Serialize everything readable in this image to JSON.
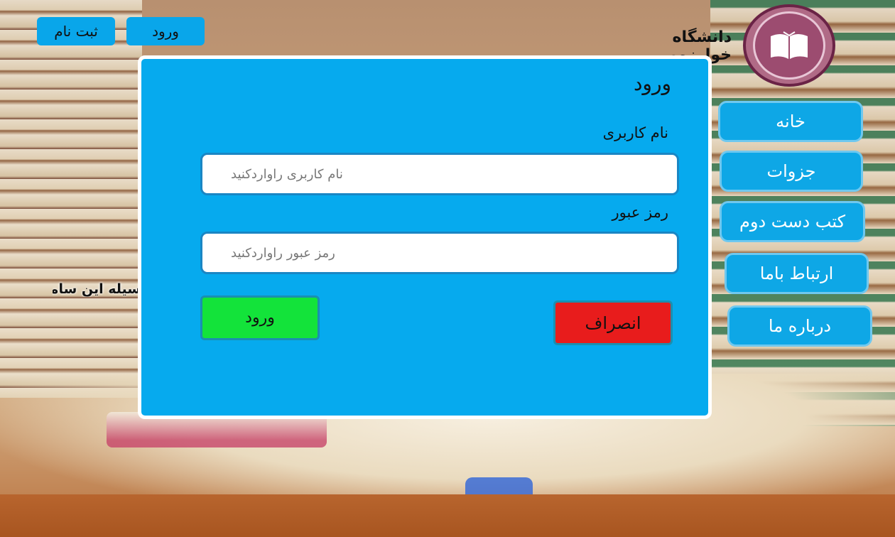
{
  "header": {
    "register_label": "ثبت نام",
    "login_label": "ورود",
    "university_name": "دانشگاه خوارزمی",
    "logo_icon": "open-book-icon"
  },
  "menu": {
    "items": [
      {
        "label": "خانه"
      },
      {
        "label": "جزوات"
      },
      {
        "label": "کتب دست دوم"
      },
      {
        "label": "ارتباط باما"
      },
      {
        "label": "درباره ما"
      }
    ]
  },
  "marquee": {
    "text": "سیله این سامانه"
  },
  "login_modal": {
    "title": "ورود",
    "username_label": "نام کاربری",
    "username_placeholder": "نام کاربری راواردکنید",
    "username_value": "",
    "password_label": "رمز عبور",
    "password_placeholder": "رمز عبور راواردکنید",
    "password_value": "",
    "submit_label": "ورود",
    "cancel_label": "انصراف"
  },
  "colors": {
    "accent": "#06aaee",
    "submit": "#13e33a",
    "cancel": "#e81c1c",
    "logo": "#9c4c70"
  }
}
